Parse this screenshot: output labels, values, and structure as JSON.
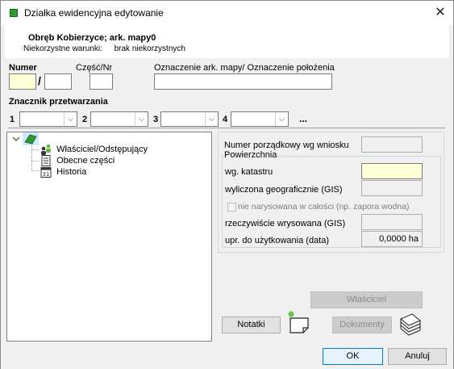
{
  "window": {
    "title": "Działka ewidencyjna edytowanie",
    "close_glyph": "✕"
  },
  "header": {
    "line1": "Obręb Kobierzyce; ark. mapy0",
    "warnings_label": "Niekorzystne warunki:",
    "warnings_value": "brak niekorzystnych"
  },
  "fields": {
    "numer_label": "Numer",
    "slash": "/",
    "czesc_label": "Część/Nr",
    "oznaczenie_label": "Oznaczenie ark. mapy/ Oznaczenie położenia",
    "numer_value": "",
    "numer2_value": "",
    "czesc_value": "",
    "oznaczenie_value": ""
  },
  "znacznik": {
    "title": "Znacznik przetwarzania",
    "items": [
      {
        "label": "1",
        "value": ""
      },
      {
        "label": "2",
        "value": ""
      },
      {
        "label": "3",
        "value": ""
      },
      {
        "label": "4",
        "value": ""
      }
    ],
    "more": "..."
  },
  "tree": {
    "root_icon": "green-parcel-icon",
    "items": [
      {
        "label": "Właściciel/Odstępujący",
        "icon": "owners-icon"
      },
      {
        "label": "Obecne części",
        "icon": "document-icon"
      },
      {
        "label": "Historia",
        "icon": "calendar-icon"
      }
    ]
  },
  "details": {
    "numer_porzadkowy_label": "Numer porządkowy wg wniosku",
    "numer_porzadkowy_value": "",
    "powierzchnia_title": "Powierzchnia",
    "wg_katastru_label": "wg. katastru",
    "wg_katastru_value": "",
    "wyliczona_label": "wyliczona geograficznie (GIS)",
    "wyliczona_value": "",
    "nie_narysowana_label": "nie narysowana w całości (np. zapora wodna)",
    "rzeczywiscie_label": "rzeczywiście wrysowana (GIS)",
    "rzeczywiscie_value": "",
    "upr_label": "upr. do użytkowania (data)",
    "upr_value": "0,0000 ha"
  },
  "buttons": {
    "wlasciciel": "Właściciel",
    "notatki": "Notatki",
    "dokumenty": "Dokumenty",
    "ok": "OK",
    "anuluj": "Anuluj"
  },
  "colors": {
    "accent": "#0078d7",
    "yellow_field": "#ffffd8",
    "green_icon": "#2e9a2e"
  }
}
